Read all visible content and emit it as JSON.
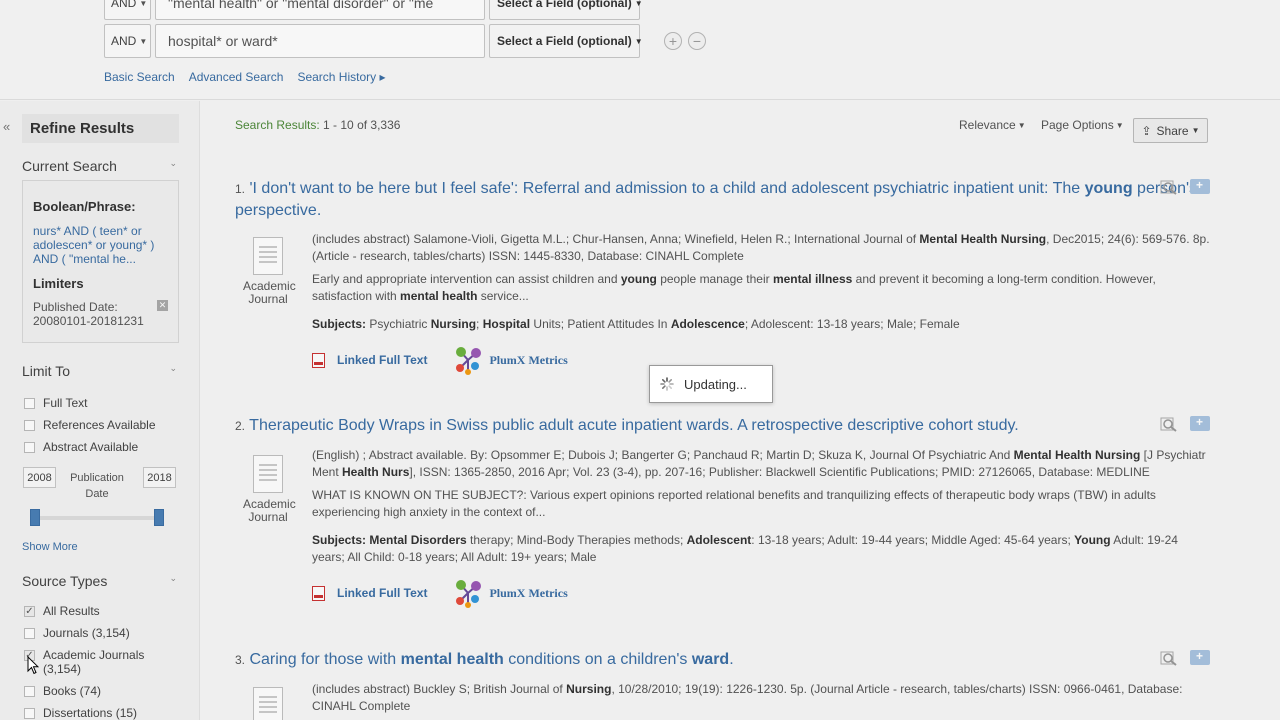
{
  "search": {
    "row1": {
      "bool": "AND",
      "term": "\"mental health\" or \"mental disorder\" or \"me",
      "field": "Select a Field (optional)"
    },
    "row2": {
      "bool": "AND",
      "term": "hospital* or ward*",
      "field": "Select a Field (optional)"
    },
    "links": {
      "basic": "Basic Search",
      "advanced": "Advanced Search",
      "history": "Search History ▸"
    }
  },
  "sidebar": {
    "collapse": "«",
    "refine_title": "Refine Results",
    "current_search": {
      "heading": "Current Search",
      "bool_label": "Boolean/Phrase:",
      "query": "nurs* AND ( teen* or adolescen* or young* ) AND ( \"mental he...",
      "limiters_label": "Limiters",
      "pub_date": "Published Date: 20080101-20181231"
    },
    "limit_to": {
      "heading": "Limit To",
      "options": [
        "Full Text",
        "References Available",
        "Abstract Available"
      ],
      "year_from": "2008",
      "year_to": "2018",
      "pub_label": "Publication Date",
      "range_from_fraction": 0.0,
      "range_to_fraction": 1.0,
      "show_more": "Show More"
    },
    "source_types": {
      "heading": "Source Types",
      "options": [
        {
          "label": "All Results",
          "checked": true
        },
        {
          "label": "Journals (3,154)",
          "checked": false
        },
        {
          "label": "Academic Journals (3,154)",
          "checked": true
        },
        {
          "label": "Books (74)",
          "checked": false
        },
        {
          "label": "Dissertations (15)",
          "checked": false
        }
      ]
    }
  },
  "results": {
    "count_label": "Search Results:",
    "count_value": "1 - 10 of 3,336",
    "relevance": "Relevance",
    "page_options": "Page Options",
    "share": "Share",
    "items": [
      {
        "num": "1.",
        "title_a": "'I don't want to be here but I feel safe': Referral and admission to a child and adolescent psychiatric inpatient unit: The ",
        "title_b": "young",
        "title_c": " person's perspective.",
        "pub_type": "Academic Journal",
        "citation_a": "(includes abstract) Salamone-Violi, Gigetta M.L.; Chur-Hansen, Anna; Winefield, Helen R.; International Journal of ",
        "citation_b": "Mental Health Nursing",
        "citation_c": ", Dec2015; 24(6): 569-576. 8p. (Article - research, tables/charts) ISSN: 1445-8330, Database: CINAHL Complete",
        "abstract_a": "Early and appropriate intervention can assist children and ",
        "abstract_b": "young",
        "abstract_c": " people manage their ",
        "abstract_d": "mental illness",
        "abstract_e": " and prevent it becoming a long-term condition. However, satisfaction with ",
        "abstract_f": "mental health",
        "abstract_g": " service...",
        "subjects_label": "Subjects:",
        "subjects_a": " Psychiatric ",
        "subjects_b": "Nursing",
        "subjects_c": "; ",
        "subjects_d": "Hospital",
        "subjects_e": " Units; Patient Attitudes In ",
        "subjects_f": "Adolescence",
        "subjects_g": "; Adolescent: 13-18 years; Male; Female",
        "full_text": "Linked Full Text",
        "plumx": "PlumX Metrics"
      },
      {
        "num": "2.",
        "title": "Therapeutic Body Wraps in Swiss public adult acute inpatient wards. A retrospective descriptive cohort study.",
        "pub_type": "Academic Journal",
        "citation_a": "(English) ; Abstract available. By: Opsommer E; Dubois J; Bangerter G; Panchaud R; Martin D; Skuza K, Journal Of Psychiatric And ",
        "citation_b": "Mental Health Nursing",
        "citation_c": " [J Psychiatr Ment ",
        "citation_d": "Health Nurs",
        "citation_e": "], ISSN: 1365-2850, 2016 Apr; Vol. 23 (3-4), pp. 207-16; Publisher: Blackwell Scientific Publications; PMID: 27126065, Database: MEDLINE",
        "abstract": "WHAT IS KNOWN ON THE SUBJECT?: Various expert opinions reported relational benefits and tranquilizing effects of therapeutic body wraps (TBW) in adults experiencing high anxiety in the context of...",
        "subjects_label": "Subjects:",
        "subjects_a": " ",
        "subjects_b": "Mental Disorders",
        "subjects_c": " therapy; Mind-Body Therapies methods; ",
        "subjects_d": "Adolescent",
        "subjects_e": ": 13-18 years; Adult: 19-44 years; Middle Aged: 45-64 years; ",
        "subjects_f": "Young",
        "subjects_g": " Adult: 19-24 years; All Child: 0-18 years; All Adult: 19+ years; Male",
        "full_text": "Linked Full Text",
        "plumx": "PlumX Metrics"
      },
      {
        "num": "3.",
        "title_a": "Caring for those with ",
        "title_b": "mental health",
        "title_c": " conditions on a children's ",
        "title_d": "ward",
        "title_e": ".",
        "citation_a": "(includes abstract) Buckley S; British Journal of ",
        "citation_b": "Nursing",
        "citation_c": ", 10/28/2010; 19(19): 1226-1230. 5p. (Journal Article - research, tables/charts) ISSN: 0966-0461, Database: CINAHL Complete"
      }
    ]
  },
  "overlay": {
    "updating": "Updating..."
  },
  "colors": {
    "link": "#3a6ea5",
    "count": "#4e8a3a",
    "slider": "#4a7fb6"
  }
}
